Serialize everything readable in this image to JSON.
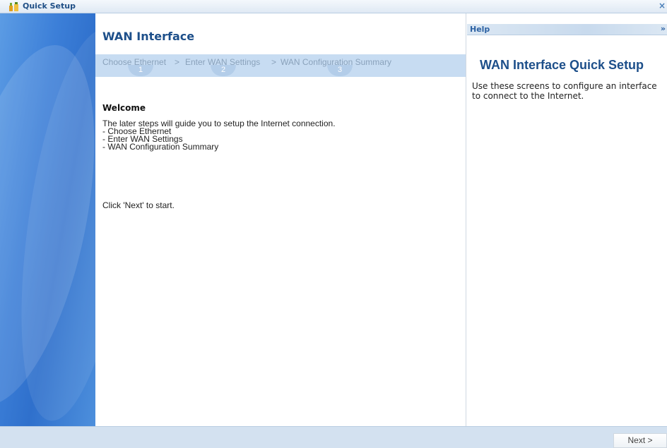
{
  "window": {
    "title": "Quick Setup",
    "close_glyph": "×",
    "icon": "quick-setup-icon"
  },
  "main": {
    "title": "WAN Interface",
    "steps": [
      {
        "label": "Choose Ethernet",
        "number": "1"
      },
      {
        "label": "Enter WAN Settings",
        "number": "2"
      },
      {
        "label": "WAN Configuration Summary",
        "number": "3"
      }
    ],
    "step_separator": ">",
    "welcome_heading": "Welcome",
    "intro_lines": [
      "The later steps will guide you to setup the Internet connection.",
      "- Choose Ethernet",
      "- Enter WAN Settings",
      "- WAN Configuration Summary"
    ],
    "start_text": "Click 'Next' to start."
  },
  "help": {
    "header_label": "Help",
    "collapse_glyph": "»",
    "title": "WAN Interface Quick Setup",
    "description": "Use these screens to configure an interface to connect to the Internet."
  },
  "footer": {
    "next_label": "Next >"
  },
  "colors": {
    "accent": "#1d4f8a",
    "stepbar": "#c7dcf2",
    "sidebar": "#3c7fd8",
    "footer": "#d3e1f0"
  }
}
